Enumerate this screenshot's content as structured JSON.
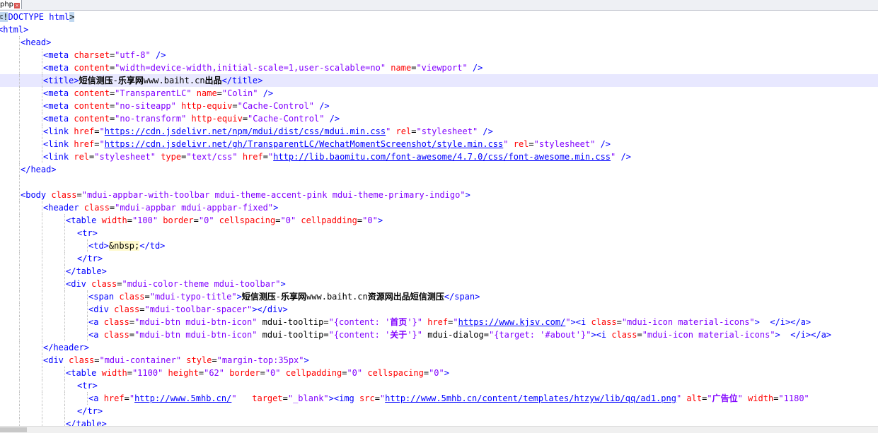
{
  "tab": {
    "label": "php"
  },
  "colors": {
    "tag": "#0000ff",
    "attribute": "#ff0000",
    "value": "#8000ff",
    "text": "#000000",
    "current_line": "#e8e8ff"
  },
  "lines": [
    {
      "indent": 0,
      "tokens": [
        [
          "sel",
          "<!"
        ],
        [
          "tag",
          "DOCTYPE html"
        ],
        [
          "sel",
          ">"
        ]
      ]
    },
    {
      "indent": 0,
      "tokens": [
        [
          "tag",
          "<html>"
        ]
      ]
    },
    {
      "indent": 1,
      "tokens": [
        [
          "tag",
          "<head>"
        ]
      ]
    },
    {
      "indent": 2,
      "tokens": [
        [
          "tag",
          "<meta "
        ],
        [
          "attr",
          "charset"
        ],
        [
          "text",
          "="
        ],
        [
          "val",
          "\"utf-8\""
        ],
        [
          "tag",
          " />"
        ]
      ]
    },
    {
      "indent": 2,
      "tokens": [
        [
          "tag",
          "<meta "
        ],
        [
          "attr",
          "content"
        ],
        [
          "text",
          "="
        ],
        [
          "val",
          "\"width=device-width,initial-scale=1,user-scalable=no\""
        ],
        [
          "attr",
          " name"
        ],
        [
          "text",
          "="
        ],
        [
          "val",
          "\"viewport\""
        ],
        [
          "tag",
          " />"
        ]
      ]
    },
    {
      "indent": 2,
      "current": true,
      "tokens": [
        [
          "tag",
          "<title>"
        ],
        [
          "textcjk",
          "短信测压"
        ],
        [
          "text",
          "-"
        ],
        [
          "textcjk",
          "乐享网"
        ],
        [
          "text",
          "www.baiht.cn"
        ],
        [
          "textcjk",
          "出品"
        ],
        [
          "tag",
          "</title>"
        ]
      ]
    },
    {
      "indent": 2,
      "tokens": [
        [
          "tag",
          "<meta "
        ],
        [
          "attr",
          "content"
        ],
        [
          "text",
          "="
        ],
        [
          "val",
          "\"TransparentLC\""
        ],
        [
          "attr",
          " name"
        ],
        [
          "text",
          "="
        ],
        [
          "val",
          "\"Colin\""
        ],
        [
          "tag",
          " />"
        ]
      ]
    },
    {
      "indent": 2,
      "tokens": [
        [
          "tag",
          "<meta "
        ],
        [
          "attr",
          "content"
        ],
        [
          "text",
          "="
        ],
        [
          "val",
          "\"no-siteapp\""
        ],
        [
          "attr",
          " http-equiv"
        ],
        [
          "text",
          "="
        ],
        [
          "val",
          "\"Cache-Control\""
        ],
        [
          "tag",
          " />"
        ]
      ]
    },
    {
      "indent": 2,
      "tokens": [
        [
          "tag",
          "<meta "
        ],
        [
          "attr",
          "content"
        ],
        [
          "text",
          "="
        ],
        [
          "val",
          "\"no-transform\""
        ],
        [
          "attr",
          " http-equiv"
        ],
        [
          "text",
          "="
        ],
        [
          "val",
          "\"Cache-Control\""
        ],
        [
          "tag",
          " />"
        ]
      ]
    },
    {
      "indent": 2,
      "tokens": [
        [
          "tag",
          "<link "
        ],
        [
          "attr",
          "href"
        ],
        [
          "text",
          "="
        ],
        [
          "val",
          "\""
        ],
        [
          "link",
          "https://cdn.jsdelivr.net/npm/mdui/dist/css/mdui.min.css"
        ],
        [
          "val",
          "\""
        ],
        [
          "attr",
          " rel"
        ],
        [
          "text",
          "="
        ],
        [
          "val",
          "\"stylesheet\""
        ],
        [
          "tag",
          " />"
        ]
      ]
    },
    {
      "indent": 2,
      "tokens": [
        [
          "tag",
          "<link "
        ],
        [
          "attr",
          "href"
        ],
        [
          "text",
          "="
        ],
        [
          "val",
          "\""
        ],
        [
          "link",
          "https://cdn.jsdelivr.net/gh/TransparentLC/WechatMomentScreenshot/style.min.css"
        ],
        [
          "val",
          "\""
        ],
        [
          "attr",
          " rel"
        ],
        [
          "text",
          "="
        ],
        [
          "val",
          "\"stylesheet\""
        ],
        [
          "tag",
          " />"
        ]
      ]
    },
    {
      "indent": 2,
      "tokens": [
        [
          "tag",
          "<link "
        ],
        [
          "attr",
          "rel"
        ],
        [
          "text",
          "="
        ],
        [
          "val",
          "\"stylesheet\""
        ],
        [
          "attr",
          " type"
        ],
        [
          "text",
          "="
        ],
        [
          "val",
          "\"text/css\""
        ],
        [
          "attr",
          " href"
        ],
        [
          "text",
          "="
        ],
        [
          "val",
          "\""
        ],
        [
          "link",
          "http://lib.baomitu.com/font-awesome/4.7.0/css/font-awesome.min.css"
        ],
        [
          "val",
          "\""
        ],
        [
          "tag",
          " />"
        ]
      ]
    },
    {
      "indent": 1,
      "tokens": [
        [
          "tag",
          "</head>"
        ]
      ]
    },
    {
      "indent": 1,
      "tokens": []
    },
    {
      "indent": 1,
      "tokens": [
        [
          "tag",
          "<body "
        ],
        [
          "attr",
          "class"
        ],
        [
          "text",
          "="
        ],
        [
          "val",
          "\"mdui-appbar-with-toolbar mdui-theme-accent-pink mdui-theme-primary-indigo\""
        ],
        [
          "tag",
          ">"
        ]
      ]
    },
    {
      "indent": 2,
      "tokens": [
        [
          "tag",
          "<header "
        ],
        [
          "attr",
          "class"
        ],
        [
          "text",
          "="
        ],
        [
          "val",
          "\"mdui-appbar mdui-appbar-fixed\""
        ],
        [
          "tag",
          ">"
        ]
      ]
    },
    {
      "indent": 3,
      "tokens": [
        [
          "tag",
          "<table "
        ],
        [
          "attr",
          "width"
        ],
        [
          "text",
          "="
        ],
        [
          "val",
          "\"100\""
        ],
        [
          "attr",
          " border"
        ],
        [
          "text",
          "="
        ],
        [
          "val",
          "\"0\""
        ],
        [
          "attr",
          " cellspacing"
        ],
        [
          "text",
          "="
        ],
        [
          "val",
          "\"0\""
        ],
        [
          "attr",
          " cellpadding"
        ],
        [
          "text",
          "="
        ],
        [
          "val",
          "\"0\""
        ],
        [
          "tag",
          ">"
        ]
      ]
    },
    {
      "indent": 3.5,
      "tokens": [
        [
          "tag",
          "<tr>"
        ]
      ]
    },
    {
      "indent": 4,
      "tokens": [
        [
          "tag",
          "<td>"
        ],
        [
          "ent",
          "&nbsp;"
        ],
        [
          "tag",
          "</td>"
        ]
      ]
    },
    {
      "indent": 3.5,
      "tokens": [
        [
          "tag",
          "</tr>"
        ]
      ]
    },
    {
      "indent": 3,
      "tokens": [
        [
          "tag",
          "</table>"
        ]
      ]
    },
    {
      "indent": 3,
      "tokens": [
        [
          "tag",
          "<div "
        ],
        [
          "attr",
          "class"
        ],
        [
          "text",
          "="
        ],
        [
          "val",
          "\"mdui-color-theme mdui-toolbar\""
        ],
        [
          "tag",
          ">"
        ]
      ]
    },
    {
      "indent": 4,
      "tokens": [
        [
          "tag",
          "<span "
        ],
        [
          "attr",
          "class"
        ],
        [
          "text",
          "="
        ],
        [
          "val",
          "\"mdui-typo-title\""
        ],
        [
          "tag",
          ">"
        ],
        [
          "textcjk",
          "短信测压"
        ],
        [
          "text",
          "-"
        ],
        [
          "textcjk",
          "乐享网"
        ],
        [
          "text",
          "www.baiht.cn"
        ],
        [
          "textcjk",
          "资源网出品短信测压"
        ],
        [
          "tag",
          "</span>"
        ]
      ]
    },
    {
      "indent": 4,
      "tokens": [
        [
          "tag",
          "<div "
        ],
        [
          "attr",
          "class"
        ],
        [
          "text",
          "="
        ],
        [
          "val",
          "\"mdui-toolbar-spacer\""
        ],
        [
          "tag",
          "></div>"
        ]
      ]
    },
    {
      "indent": 4,
      "tokens": [
        [
          "tag",
          "<a "
        ],
        [
          "attr",
          "class"
        ],
        [
          "text",
          "="
        ],
        [
          "val",
          "\"mdui-btn mdui-btn-icon\""
        ],
        [
          "text",
          " mdui-tooltip"
        ],
        [
          "text",
          "="
        ],
        [
          "val",
          "\"{content: '"
        ],
        [
          "cjk",
          "首页"
        ],
        [
          "val",
          "'}\""
        ],
        [
          "attr",
          " href"
        ],
        [
          "text",
          "="
        ],
        [
          "val",
          "\""
        ],
        [
          "link",
          "https://www.kjsv.com/"
        ],
        [
          "val",
          "\""
        ],
        [
          "tag",
          "><i "
        ],
        [
          "attr",
          "class"
        ],
        [
          "text",
          "="
        ],
        [
          "val",
          "\"mdui-icon material-icons\""
        ],
        [
          "tag",
          ">"
        ],
        [
          "text",
          "  "
        ],
        [
          "tag",
          "</i></a>"
        ]
      ]
    },
    {
      "indent": 4,
      "tokens": [
        [
          "tag",
          "<a "
        ],
        [
          "attr",
          "class"
        ],
        [
          "text",
          "="
        ],
        [
          "val",
          "\"mdui-btn mdui-btn-icon\""
        ],
        [
          "text",
          " mdui-tooltip"
        ],
        [
          "text",
          "="
        ],
        [
          "val",
          "\"{content: '"
        ],
        [
          "cjk",
          "关于"
        ],
        [
          "val",
          "'}\""
        ],
        [
          "text",
          " mdui-dialog"
        ],
        [
          "text",
          "="
        ],
        [
          "val",
          "\"{target: '#about'}\""
        ],
        [
          "tag",
          "><i "
        ],
        [
          "attr",
          "class"
        ],
        [
          "text",
          "="
        ],
        [
          "val",
          "\"mdui-icon material-icons\""
        ],
        [
          "tag",
          ">"
        ],
        [
          "text",
          "  "
        ],
        [
          "tag",
          "</i></a>"
        ]
      ]
    },
    {
      "indent": 2,
      "tokens": [
        [
          "tag",
          "</header>"
        ]
      ]
    },
    {
      "indent": 2,
      "tokens": [
        [
          "tag",
          "<div "
        ],
        [
          "attr",
          "class"
        ],
        [
          "text",
          "="
        ],
        [
          "val",
          "\"mdui-container\""
        ],
        [
          "attr",
          " style"
        ],
        [
          "text",
          "="
        ],
        [
          "val",
          "\"margin-top:35px\""
        ],
        [
          "tag",
          ">"
        ]
      ]
    },
    {
      "indent": 3,
      "tokens": [
        [
          "tag",
          "<table "
        ],
        [
          "attr",
          "width"
        ],
        [
          "text",
          "="
        ],
        [
          "val",
          "\"1100\""
        ],
        [
          "attr",
          " height"
        ],
        [
          "text",
          "="
        ],
        [
          "val",
          "\"62\""
        ],
        [
          "attr",
          " border"
        ],
        [
          "text",
          "="
        ],
        [
          "val",
          "\"0\""
        ],
        [
          "attr",
          " cellpadding"
        ],
        [
          "text",
          "="
        ],
        [
          "val",
          "\"0\""
        ],
        [
          "attr",
          " cellspacing"
        ],
        [
          "text",
          "="
        ],
        [
          "val",
          "\"0\""
        ],
        [
          "tag",
          ">"
        ]
      ]
    },
    {
      "indent": 3.5,
      "tokens": [
        [
          "tag",
          "<tr>"
        ]
      ]
    },
    {
      "indent": 4,
      "tokens": [
        [
          "tag",
          "<a "
        ],
        [
          "attr",
          "href"
        ],
        [
          "text",
          "="
        ],
        [
          "val",
          "\""
        ],
        [
          "link",
          "http://www.5mhb.cn/"
        ],
        [
          "val",
          "\""
        ],
        [
          "text",
          "  "
        ],
        [
          "attr",
          " target"
        ],
        [
          "text",
          "="
        ],
        [
          "val",
          "\"_blank\""
        ],
        [
          "tag",
          "><img "
        ],
        [
          "attr",
          "src"
        ],
        [
          "text",
          "="
        ],
        [
          "val",
          "\""
        ],
        [
          "link",
          "http://www.5mhb.cn/content/templates/htzyw/lib/qq/ad1.png"
        ],
        [
          "val",
          "\""
        ],
        [
          "attr",
          " alt"
        ],
        [
          "text",
          "="
        ],
        [
          "val",
          "\""
        ],
        [
          "cjk",
          "广告位"
        ],
        [
          "val",
          "\""
        ],
        [
          "attr",
          " width"
        ],
        [
          "text",
          "="
        ],
        [
          "val",
          "\"1180\""
        ]
      ]
    },
    {
      "indent": 3.5,
      "tokens": [
        [
          "tag",
          "</tr>"
        ]
      ]
    },
    {
      "indent": 3,
      "tokens": [
        [
          "tag",
          "</table>"
        ]
      ]
    }
  ]
}
